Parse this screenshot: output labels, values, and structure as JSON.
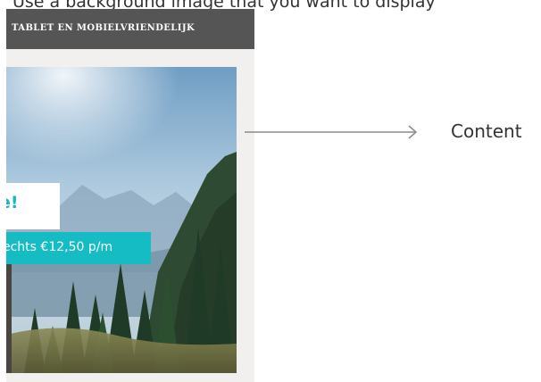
{
  "caption": {
    "text": "Use a background image that you want to display"
  },
  "phone": {
    "topbar_title": "TABLET EN MOBIELVRIENDELIJK",
    "hero": {
      "image": "mountain-forest-landscape",
      "headline": "e!",
      "price_label": "echts €12,50 p/m"
    }
  },
  "annotation": {
    "label": "Content",
    "arrow_icon": "arrow-right-icon"
  },
  "colors": {
    "topbar": "#555555",
    "accent_teal": "#16bcc4",
    "frame_bg": "#f1f0ef"
  }
}
